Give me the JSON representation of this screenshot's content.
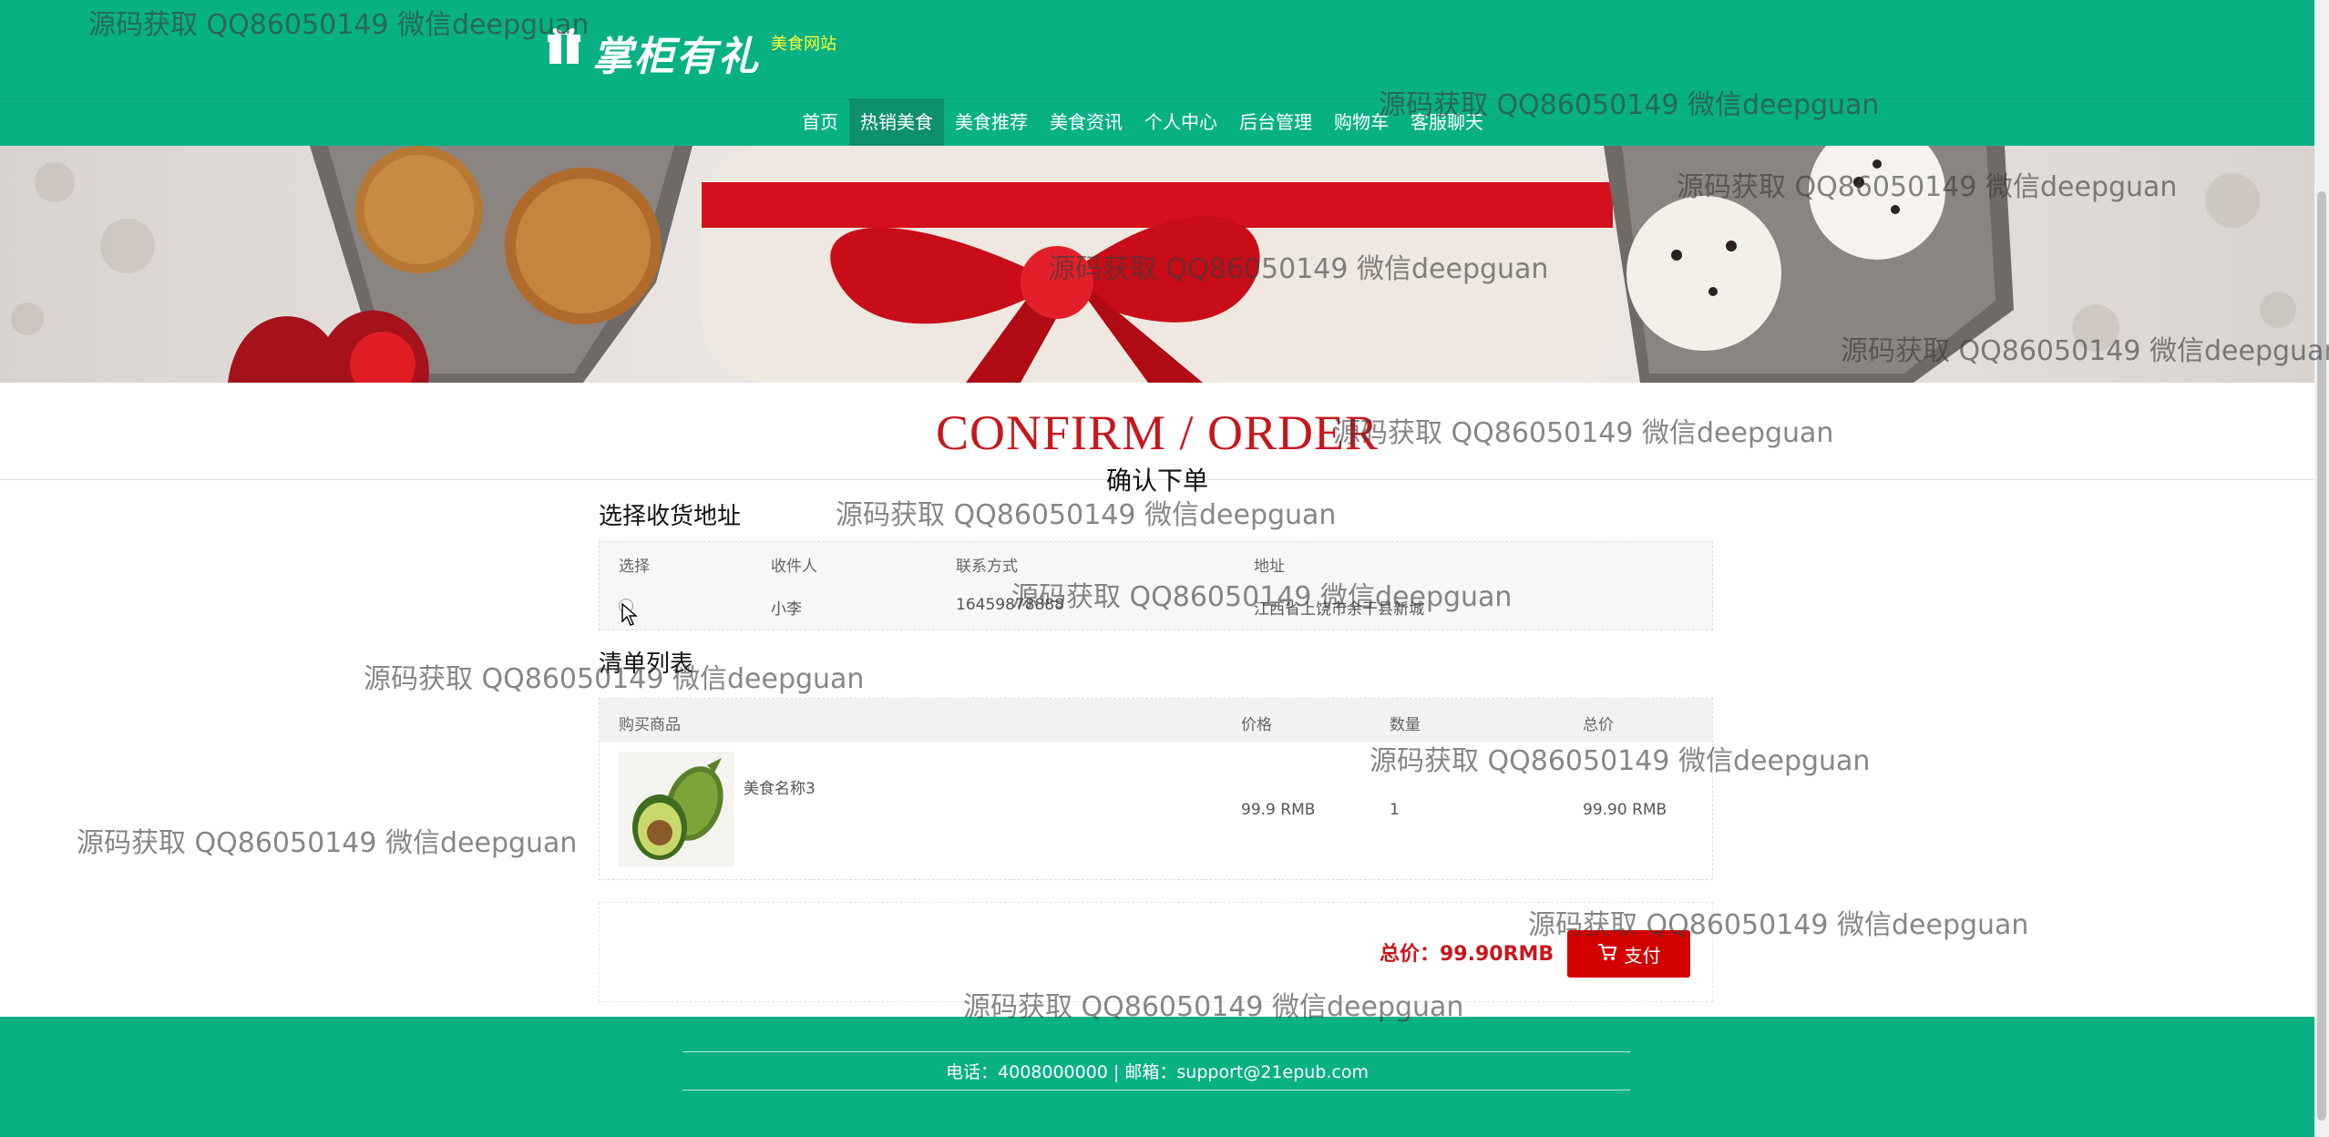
{
  "header": {
    "logo_text": "掌柜有礼",
    "site_subtitle": "美食网站",
    "nav": [
      {
        "label": "首页",
        "active": false
      },
      {
        "label": "热销美食",
        "active": true
      },
      {
        "label": "美食推荐",
        "active": false
      },
      {
        "label": "美食资讯",
        "active": false
      },
      {
        "label": "个人中心",
        "active": false
      },
      {
        "label": "后台管理",
        "active": false
      },
      {
        "label": "购物车",
        "active": false
      },
      {
        "label": "客服聊天",
        "active": false
      }
    ]
  },
  "page": {
    "title_en": "CONFIRM / ORDER",
    "title_cn": "确认下单"
  },
  "address": {
    "section_title": "选择收货地址",
    "headers": [
      "选择",
      "收件人",
      "联系方式",
      "地址"
    ],
    "rows": [
      {
        "recipient": "小李",
        "phone": "16459878888",
        "address": "江西省上饶市余干县新城"
      }
    ]
  },
  "order": {
    "section_title": "清单列表",
    "headers": [
      "购买商品",
      "价格",
      "数量",
      "总价"
    ],
    "items": [
      {
        "name": "美食名称3",
        "price": "99.9 RMB",
        "qty": "1",
        "total": "99.90 RMB",
        "image": "avocado"
      }
    ]
  },
  "summary": {
    "total_label": "总价：99.90RMB",
    "pay_label": "支付"
  },
  "footer": {
    "text": "电话：4008000000 | 邮箱：support@21epub.com"
  },
  "watermark": "源码获取 QQ86050149 微信deepguan",
  "colors": {
    "brand_green": "#08b184",
    "accent_red": "#c8161d",
    "pay_button": "#d40000",
    "logo_subtitle": "#ffff33"
  }
}
